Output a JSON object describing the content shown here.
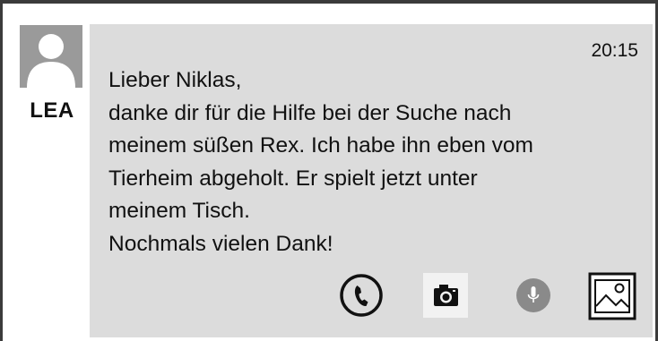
{
  "sender": {
    "name": "LEA",
    "avatar_icon": "user-avatar-icon"
  },
  "message": {
    "time": "20:15",
    "lines": [
      "Lieber Niklas,",
      "danke dir für die Hilfe bei der Suche nach",
      "meinem süßen Rex. Ich habe ihn eben vom",
      "Tierheim abgeholt. Er spielt jetzt unter",
      "meinem Tisch.",
      "Nochmals vielen Dank!"
    ]
  },
  "actions": [
    {
      "icon": "phone-icon"
    },
    {
      "icon": "camera-icon"
    },
    {
      "icon": "microphone-icon"
    },
    {
      "icon": "image-icon"
    }
  ],
  "colors": {
    "bubble": "#dcdcdc",
    "avatar_bg": "#9a9a9a",
    "frame": "#3b3b3b"
  }
}
